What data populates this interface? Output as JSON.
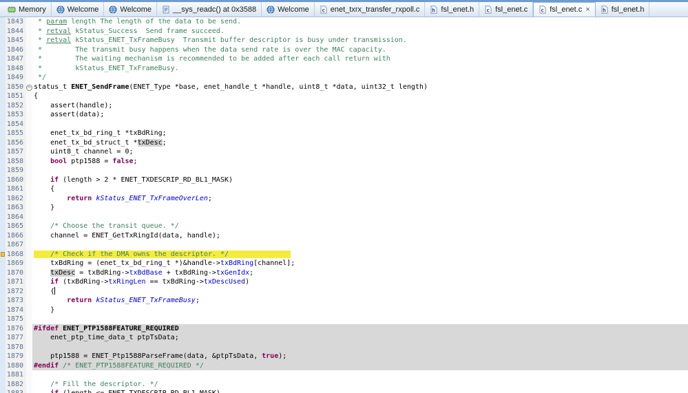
{
  "colors": {
    "highlight": "#f4eb3c",
    "inactive_block": "#d8d8d8",
    "comment": "#3F7F5F",
    "keyword": "#7F0055",
    "field": "#0000C0"
  },
  "tabbar": {
    "tabs": [
      {
        "label": "Memory",
        "icon": "memory-icon",
        "active": false
      },
      {
        "label": "Welcome",
        "icon": "welcome-icon",
        "active": false
      },
      {
        "label": "Welcome",
        "icon": "welcome-icon",
        "active": false
      },
      {
        "label": "__sys_readc() at 0x3588",
        "icon": "stack-frame-icon",
        "active": false
      },
      {
        "label": "Welcome",
        "icon": "welcome-icon",
        "active": false
      },
      {
        "label": "enet_txrx_transfer_rxpoll.c",
        "icon": "c-file-icon",
        "active": false
      },
      {
        "label": "fsl_enet.h",
        "icon": "h-file-icon",
        "active": false
      },
      {
        "label": "fsl_enet.c",
        "icon": "c-file-icon",
        "active": false
      },
      {
        "label": "fsl_enet.c",
        "icon": "c-file-icon",
        "active": true,
        "close": "×"
      },
      {
        "label": "fsl_enet.h",
        "icon": "h-file-icon",
        "active": false
      }
    ]
  },
  "editor": {
    "lines": [
      {
        "num": 1843,
        "segs": [
          {
            "t": " * ",
            "c": "cm"
          },
          {
            "t": "param",
            "c": "dt"
          },
          {
            "t": " length The length of the data to be send.",
            "c": "cm"
          }
        ]
      },
      {
        "num": 1844,
        "segs": [
          {
            "t": " * ",
            "c": "cm"
          },
          {
            "t": "retval",
            "c": "dt"
          },
          {
            "t": " kStatus_Success  Send frame succeed.",
            "c": "cm"
          }
        ]
      },
      {
        "num": 1845,
        "segs": [
          {
            "t": " * ",
            "c": "cm"
          },
          {
            "t": "retval",
            "c": "dt"
          },
          {
            "t": " kStatus_ENET_TxFrameBusy  Transmit buffer descriptor is busy under transmission.",
            "c": "cm"
          }
        ]
      },
      {
        "num": 1846,
        "segs": [
          {
            "t": " *        The transmit busy happens when the data send rate is over the MAC capacity.",
            "c": "cm"
          }
        ]
      },
      {
        "num": 1847,
        "segs": [
          {
            "t": " *        The waiting mechanism is recommended to be added after each call return with",
            "c": "cm"
          }
        ]
      },
      {
        "num": 1848,
        "segs": [
          {
            "t": " *        kStatus_ENET_TxFrameBusy.",
            "c": "cm"
          }
        ]
      },
      {
        "num": 1849,
        "segs": [
          {
            "t": " */",
            "c": "cm"
          }
        ]
      },
      {
        "num": 1850,
        "fold": true,
        "segs": [
          {
            "t": "status_t ",
            "c": "p"
          },
          {
            "t": "ENET_SendFrame",
            "c": "fnb"
          },
          {
            "t": "(ENET_Type *base, enet_handle_t *handle, uint8_t *data, uint32_t length)",
            "c": "p"
          }
        ]
      },
      {
        "num": 1851,
        "segs": [
          {
            "t": "{",
            "c": "p"
          }
        ]
      },
      {
        "num": 1852,
        "segs": [
          {
            "t": "    assert(handle);",
            "c": "p"
          }
        ]
      },
      {
        "num": 1853,
        "segs": [
          {
            "t": "    assert(data);",
            "c": "p"
          }
        ]
      },
      {
        "num": 1854,
        "segs": []
      },
      {
        "num": 1855,
        "segs": [
          {
            "t": "    enet_tx_bd_ring_t *txBdRing;",
            "c": "p"
          }
        ]
      },
      {
        "num": 1856,
        "segs": [
          {
            "t": "    enet_tx_bd_struct_t *",
            "c": "p"
          },
          {
            "t": "txDesc",
            "c": "occ"
          },
          {
            "t": ";",
            "c": "p"
          }
        ]
      },
      {
        "num": 1857,
        "segs": [
          {
            "t": "    uint8_t channel = 0;",
            "c": "p"
          }
        ]
      },
      {
        "num": 1858,
        "segs": [
          {
            "t": "    ",
            "c": "p"
          },
          {
            "t": "bool",
            "c": "kw"
          },
          {
            "t": " ptp1588 = ",
            "c": "p"
          },
          {
            "t": "false",
            "c": "kw"
          },
          {
            "t": ";",
            "c": "p"
          }
        ]
      },
      {
        "num": 1859,
        "segs": []
      },
      {
        "num": 1860,
        "segs": [
          {
            "t": "    ",
            "c": "p"
          },
          {
            "t": "if",
            "c": "kw"
          },
          {
            "t": " (length > 2 * ENET_TXDESCRIP_RD_BL1_MASK)",
            "c": "p"
          }
        ]
      },
      {
        "num": 1861,
        "segs": [
          {
            "t": "    {",
            "c": "p"
          }
        ]
      },
      {
        "num": 1862,
        "segs": [
          {
            "t": "        ",
            "c": "p"
          },
          {
            "t": "return",
            "c": "kw"
          },
          {
            "t": " ",
            "c": "p"
          },
          {
            "t": "kStatus_ENET_TxFrameOverLen",
            "c": "en"
          },
          {
            "t": ";",
            "c": "p"
          }
        ]
      },
      {
        "num": 1863,
        "segs": [
          {
            "t": "    }",
            "c": "p"
          }
        ]
      },
      {
        "num": 1864,
        "segs": []
      },
      {
        "num": 1865,
        "segs": [
          {
            "t": "    ",
            "c": "p"
          },
          {
            "t": "/* Choose the transit queue. */",
            "c": "cm"
          }
        ]
      },
      {
        "num": 1866,
        "segs": [
          {
            "t": "    channel = ENET_GetTxRingId(data, handle);",
            "c": "p"
          }
        ]
      },
      {
        "num": 1867,
        "segs": []
      },
      {
        "num": 1868,
        "marker": true,
        "segs": [
          {
            "t": "    ",
            "c": "hly"
          },
          {
            "t": "/* Check if the DMA ",
            "c": "cm hly"
          },
          {
            "t": "own",
            "c": "cm hly occ"
          },
          {
            "t": "s the descriptor. */",
            "c": "cm hly"
          },
          {
            "t": "               ",
            "c": "hly"
          }
        ]
      },
      {
        "num": 1869,
        "segs": [
          {
            "t": "    txBdRing = (enet_tx_bd_ring_t *)&handle->",
            "c": "p"
          },
          {
            "t": "txBdRing",
            "c": "fld"
          },
          {
            "t": "[channel];",
            "c": "p"
          }
        ]
      },
      {
        "num": 1870,
        "segs": [
          {
            "t": "    ",
            "c": "p"
          },
          {
            "t": "txDesc",
            "c": "occ"
          },
          {
            "t": " = txBdRing->",
            "c": "p"
          },
          {
            "t": "txBdBase",
            "c": "fld"
          },
          {
            "t": " + txBdRing->",
            "c": "p"
          },
          {
            "t": "txGenIdx",
            "c": "fld"
          },
          {
            "t": ";",
            "c": "p"
          }
        ]
      },
      {
        "num": 1871,
        "segs": [
          {
            "t": "    ",
            "c": "p"
          },
          {
            "t": "if",
            "c": "kw"
          },
          {
            "t": " (txBdRing->",
            "c": "p"
          },
          {
            "t": "txRingLen",
            "c": "fld"
          },
          {
            "t": " == txBdRing->",
            "c": "p"
          },
          {
            "t": "txDescUsed",
            "c": "fld"
          },
          {
            "t": ")",
            "c": "p"
          }
        ]
      },
      {
        "num": 1872,
        "segs": [
          {
            "t": "    {",
            "c": "p"
          },
          {
            "t": "",
            "c": "caret"
          }
        ]
      },
      {
        "num": 1873,
        "segs": [
          {
            "t": "        ",
            "c": "p"
          },
          {
            "t": "return",
            "c": "kw"
          },
          {
            "t": " ",
            "c": "p"
          },
          {
            "t": "kStatus_ENET_TxFrameBusy",
            "c": "en"
          },
          {
            "t": ";",
            "c": "p"
          }
        ]
      },
      {
        "num": 1874,
        "segs": [
          {
            "t": "    }",
            "c": "p"
          }
        ]
      },
      {
        "num": 1875,
        "segs": []
      },
      {
        "num": 1876,
        "bg": "inactive",
        "segs": [
          {
            "t": "#ifdef",
            "c": "kw"
          },
          {
            "t": " ",
            "c": "p"
          },
          {
            "t": "ENET_PTP1588FEATURE_REQUIRED",
            "c": "mac"
          }
        ]
      },
      {
        "num": 1877,
        "bg": "inactive",
        "segs": [
          {
            "t": "    enet_ptp_time_data_t ptpTsData;",
            "c": "p"
          }
        ]
      },
      {
        "num": 1878,
        "bg": "inactive",
        "segs": []
      },
      {
        "num": 1879,
        "bg": "inactive",
        "segs": [
          {
            "t": "    ptp1588 = ENET_Ptp1588ParseFrame(data, &ptpTsData, ",
            "c": "p"
          },
          {
            "t": "true",
            "c": "kw"
          },
          {
            "t": ");",
            "c": "p"
          }
        ]
      },
      {
        "num": 1880,
        "bg": "inactive",
        "segs": [
          {
            "t": "#endif",
            "c": "kw"
          },
          {
            "t": " ",
            "c": "p"
          },
          {
            "t": "/* ENET_PTP1588FEATURE_REQUIRED */",
            "c": "cm"
          }
        ]
      },
      {
        "num": 1881,
        "segs": []
      },
      {
        "num": 1882,
        "segs": [
          {
            "t": "    ",
            "c": "p"
          },
          {
            "t": "/* Fill the descriptor. */",
            "c": "cm"
          }
        ]
      },
      {
        "num": 1883,
        "segs": [
          {
            "t": "    ",
            "c": "p"
          },
          {
            "t": "if",
            "c": "kw"
          },
          {
            "t": " (length <= ENET_TXDESCRIP_RD_BL1_MASK)",
            "c": "p"
          }
        ]
      }
    ]
  }
}
